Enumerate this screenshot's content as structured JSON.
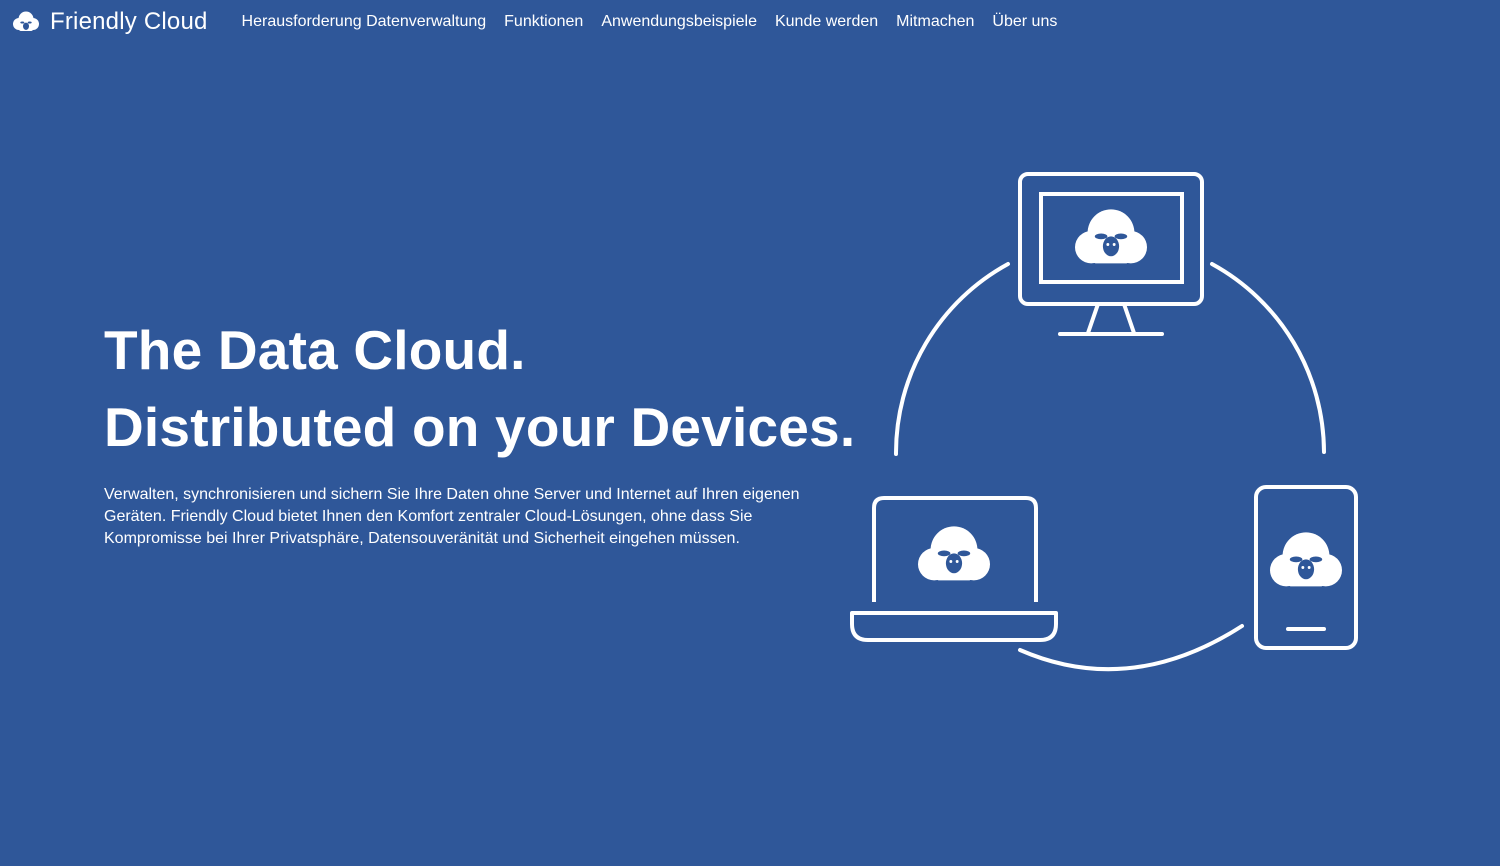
{
  "brand": {
    "name": "Friendly Cloud",
    "logo_icon": "sheep-cloud-icon"
  },
  "nav": {
    "items": [
      {
        "label": "Herausforderung Datenverwaltung"
      },
      {
        "label": "Funktionen"
      },
      {
        "label": "Anwendungsbeispiele"
      },
      {
        "label": "Kunde werden"
      },
      {
        "label": "Mitmachen"
      },
      {
        "label": "Über uns"
      }
    ]
  },
  "hero": {
    "title_line1": "The Data Cloud.",
    "title_line2": "Distributed on your Devices.",
    "description": "Verwalten, synchronisieren und sichern Sie Ihre Daten ohne Server und Internet auf Ihren eigenen Geräten. Friendly Cloud bietet Ihnen den Komfort zentraler Cloud-Lösungen, ohne dass Sie Kompromisse bei Ihrer Privatsphäre, Datensouveränität und Sicherheit eingehen müssen."
  },
  "illustration": {
    "devices": [
      "desktop-monitor-icon",
      "laptop-icon",
      "smartphone-icon"
    ],
    "colors": {
      "background": "#2f5799",
      "foreground": "#ffffff"
    }
  }
}
